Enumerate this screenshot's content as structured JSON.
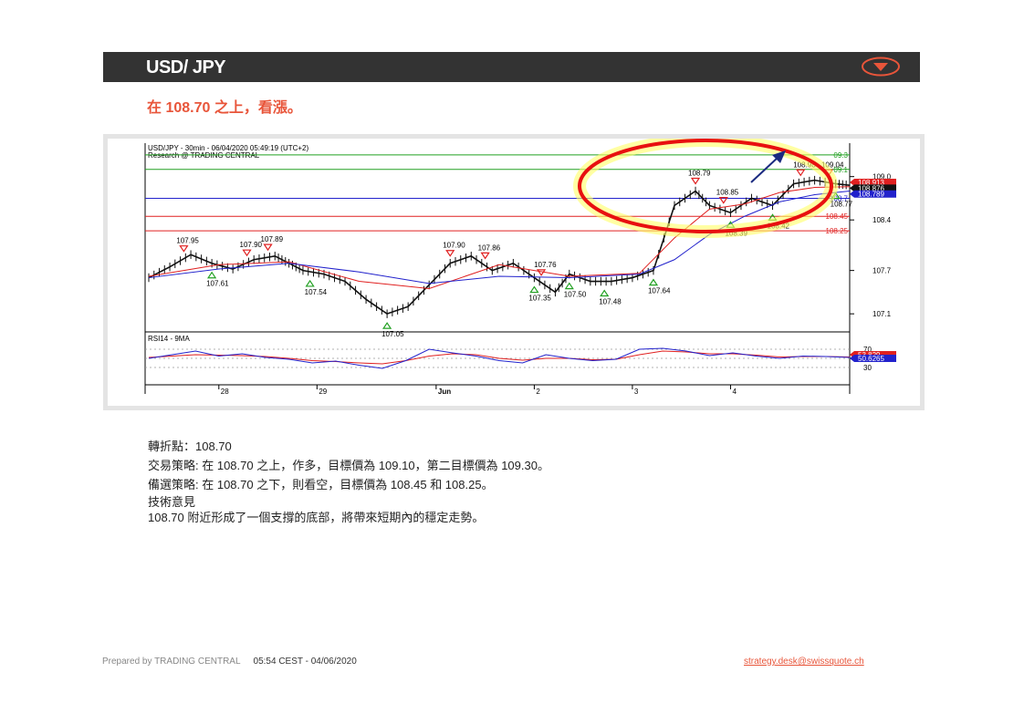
{
  "header": {
    "title": "USD/ JPY",
    "accent": "#e8553a",
    "bar_color": "#333333",
    "menu_icon": "chevron-down-icon"
  },
  "subtitle": "在 108.70 之上，看漲。",
  "analysis": {
    "pivot": "轉折點：108.70",
    "strategy": "交易策略: 在 108.70 之上，作多，目標價為 109.10，第二目標價為 109.30。",
    "alternative": "備選策略: 在 108.70 之下，則看空，目標價為 108.45 和 108.25。",
    "comment_title": "技術意見",
    "comment": "108.70 附近形成了一個支撐的底部，將帶來短期內的穩定走勢。"
  },
  "footer": {
    "prepared": "Prepared by TRADING CENTRAL",
    "time": "05:54 CEST - 04/06/2020",
    "email": "strategy.desk@swissquote.ch"
  },
  "chart_data": {
    "type": "line",
    "title": "USD/JPY - 30min - 06/04/2020 05:49:19 (UTC+2)",
    "subtitle": "Research @ TRADING CENTRAL",
    "ylim": [
      106.9,
      109.4
    ],
    "y_ticks": [
      "109.0",
      "108.4",
      "107.7",
      "107.1"
    ],
    "x_ticks": [
      "28",
      "29",
      "Jun",
      "2",
      "3",
      "4"
    ],
    "levels": [
      {
        "value": 109.3,
        "label": "09.3",
        "color": "#22a022"
      },
      {
        "value": 109.1,
        "label": "09.1",
        "color": "#22a022"
      },
      {
        "value": 108.7,
        "label": "108.7",
        "color": "#2222cc"
      },
      {
        "value": 108.45,
        "label": "108.45",
        "color": "#e02020"
      },
      {
        "value": 108.25,
        "label": "108.25",
        "color": "#e02020"
      }
    ],
    "price_tags": [
      {
        "label": "108.913",
        "bg": "#e02020"
      },
      {
        "label": "108.876",
        "bg": "#111111"
      },
      {
        "label": "108.789",
        "bg": "#2222cc"
      }
    ],
    "series": [
      {
        "name": "price",
        "color": "#111111",
        "x": [
          0,
          3,
          6,
          9,
          12,
          15,
          18,
          20,
          22,
          25,
          28,
          31,
          34,
          37,
          40,
          43,
          46,
          49,
          52,
          55,
          58,
          60,
          63,
          66,
          69,
          72,
          75,
          78,
          80,
          83,
          86,
          89,
          92,
          95,
          98,
          100
        ],
        "y": [
          107.6,
          107.75,
          107.92,
          107.8,
          107.72,
          107.85,
          107.9,
          107.8,
          107.7,
          107.65,
          107.55,
          107.3,
          107.1,
          107.2,
          107.5,
          107.8,
          107.9,
          107.7,
          107.8,
          107.6,
          107.4,
          107.65,
          107.55,
          107.55,
          107.6,
          107.7,
          108.6,
          108.8,
          108.6,
          108.5,
          108.7,
          108.6,
          108.9,
          108.95,
          108.9,
          108.88
        ]
      },
      {
        "name": "MA-fast",
        "color": "#e02020",
        "x": [
          0,
          10,
          20,
          30,
          40,
          50,
          60,
          70,
          75,
          80,
          85,
          90,
          95,
          100
        ],
        "y": [
          107.62,
          107.78,
          107.82,
          107.55,
          107.45,
          107.78,
          107.62,
          107.66,
          108.15,
          108.55,
          108.62,
          108.78,
          108.85,
          108.86
        ]
      },
      {
        "name": "MA-slow",
        "color": "#2222cc",
        "x": [
          0,
          10,
          20,
          30,
          40,
          50,
          60,
          70,
          75,
          80,
          85,
          90,
          95,
          100
        ],
        "y": [
          107.6,
          107.72,
          107.8,
          107.68,
          107.52,
          107.62,
          107.6,
          107.65,
          107.85,
          108.2,
          108.45,
          108.65,
          108.75,
          108.8
        ]
      }
    ],
    "highs": [
      {
        "x": 5,
        "label": "107.95"
      },
      {
        "x": 14,
        "label": "107.90"
      },
      {
        "x": 17,
        "label": "107.89"
      },
      {
        "x": 43,
        "label": "107.90"
      },
      {
        "x": 48,
        "label": "107.86"
      },
      {
        "x": 56,
        "label": "107.76"
      },
      {
        "x": 78,
        "label": "108.79"
      },
      {
        "x": 82,
        "label": "108.85"
      },
      {
        "x": 93,
        "label": "108.98"
      },
      {
        "x": 97,
        "label": "109.04"
      }
    ],
    "lows": [
      {
        "x": 9,
        "label": "107.61"
      },
      {
        "x": 23,
        "label": "107.54"
      },
      {
        "x": 34,
        "label": "107.05"
      },
      {
        "x": 55,
        "label": "107.35"
      },
      {
        "x": 60,
        "label": "107.50"
      },
      {
        "x": 65,
        "label": "107.48"
      },
      {
        "x": 72,
        "label": "107.64"
      },
      {
        "x": 83,
        "label": "108.39"
      },
      {
        "x": 89,
        "label": "108.42"
      },
      {
        "x": 98,
        "label": "108.77"
      }
    ],
    "rsi": {
      "title": "RSI14 - 9MA",
      "y_ticks": [
        "70",
        "30"
      ],
      "tags": [
        {
          "label": "53.829",
          "bg": "#e02020"
        },
        {
          "label": "50.6265",
          "bg": "#2222cc"
        }
      ],
      "rsi_values": [
        50,
        58,
        66,
        55,
        60,
        52,
        48,
        40,
        44,
        35,
        28,
        45,
        70,
        62,
        55,
        45,
        40,
        58,
        50,
        45,
        48,
        70,
        72,
        66,
        56,
        62,
        55,
        50,
        55,
        54,
        52
      ],
      "ma_values": [
        52,
        55,
        58,
        57,
        56,
        54,
        50,
        45,
        43,
        40,
        38,
        45,
        55,
        60,
        58,
        50,
        46,
        50,
        50,
        47,
        48,
        58,
        66,
        64,
        60,
        60,
        57,
        53,
        54,
        54,
        53
      ]
    },
    "annotations": {
      "circle_color": "#e81010",
      "glow_color": "#ffff66",
      "arrow_color": "#1a2a80"
    }
  }
}
